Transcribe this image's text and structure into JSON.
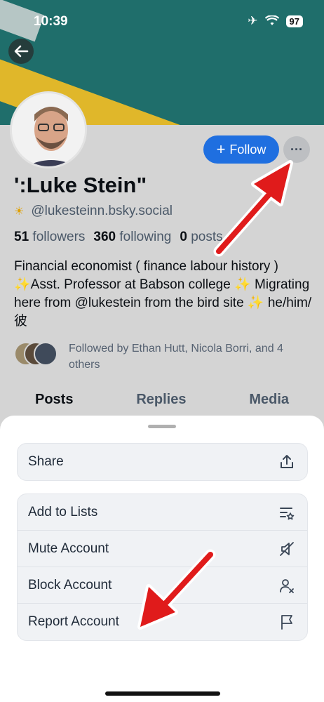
{
  "status_bar": {
    "time": "10:39",
    "battery": "97"
  },
  "profile": {
    "display_name": "':Luke Stein\"",
    "handle": "@lukesteinn.bsky.social",
    "followers_count": "51",
    "followers_label": "followers",
    "following_count": "360",
    "following_label": "following",
    "posts_count": "0",
    "posts_label": "posts",
    "bio": "Financial economist ( finance labour history ) ✨Asst. Professor at Babson college ✨ Migrating here from @lukestein from the bird site ✨ he/him/彼",
    "followed_by": "Followed by Ethan Hutt, Nicola Borri, and 4 others",
    "follow_button": "Follow"
  },
  "tabs": [
    "Posts",
    "Replies",
    "Media"
  ],
  "sheet": {
    "share": "Share",
    "add_to_lists": "Add to Lists",
    "mute_account": "Mute Account",
    "block_account": "Block Account",
    "report_account": "Report Account"
  },
  "colors": {
    "accent": "#1f6fe0",
    "annotation_arrow": "#e01b1b"
  }
}
